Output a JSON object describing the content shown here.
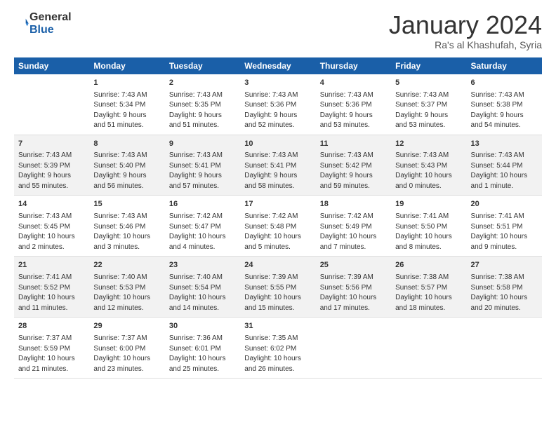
{
  "logo": {
    "line1": "General",
    "line2": "Blue"
  },
  "header": {
    "month": "January 2024",
    "location": "Ra's al Khashufah, Syria"
  },
  "weekdays": [
    "Sunday",
    "Monday",
    "Tuesday",
    "Wednesday",
    "Thursday",
    "Friday",
    "Saturday"
  ],
  "weeks": [
    [
      {
        "day": "",
        "info": ""
      },
      {
        "day": "1",
        "info": "Sunrise: 7:43 AM\nSunset: 5:34 PM\nDaylight: 9 hours\nand 51 minutes."
      },
      {
        "day": "2",
        "info": "Sunrise: 7:43 AM\nSunset: 5:35 PM\nDaylight: 9 hours\nand 51 minutes."
      },
      {
        "day": "3",
        "info": "Sunrise: 7:43 AM\nSunset: 5:36 PM\nDaylight: 9 hours\nand 52 minutes."
      },
      {
        "day": "4",
        "info": "Sunrise: 7:43 AM\nSunset: 5:36 PM\nDaylight: 9 hours\nand 53 minutes."
      },
      {
        "day": "5",
        "info": "Sunrise: 7:43 AM\nSunset: 5:37 PM\nDaylight: 9 hours\nand 53 minutes."
      },
      {
        "day": "6",
        "info": "Sunrise: 7:43 AM\nSunset: 5:38 PM\nDaylight: 9 hours\nand 54 minutes."
      }
    ],
    [
      {
        "day": "7",
        "info": "Sunrise: 7:43 AM\nSunset: 5:39 PM\nDaylight: 9 hours\nand 55 minutes."
      },
      {
        "day": "8",
        "info": "Sunrise: 7:43 AM\nSunset: 5:40 PM\nDaylight: 9 hours\nand 56 minutes."
      },
      {
        "day": "9",
        "info": "Sunrise: 7:43 AM\nSunset: 5:41 PM\nDaylight: 9 hours\nand 57 minutes."
      },
      {
        "day": "10",
        "info": "Sunrise: 7:43 AM\nSunset: 5:41 PM\nDaylight: 9 hours\nand 58 minutes."
      },
      {
        "day": "11",
        "info": "Sunrise: 7:43 AM\nSunset: 5:42 PM\nDaylight: 9 hours\nand 59 minutes."
      },
      {
        "day": "12",
        "info": "Sunrise: 7:43 AM\nSunset: 5:43 PM\nDaylight: 10 hours\nand 0 minutes."
      },
      {
        "day": "13",
        "info": "Sunrise: 7:43 AM\nSunset: 5:44 PM\nDaylight: 10 hours\nand 1 minute."
      }
    ],
    [
      {
        "day": "14",
        "info": "Sunrise: 7:43 AM\nSunset: 5:45 PM\nDaylight: 10 hours\nand 2 minutes."
      },
      {
        "day": "15",
        "info": "Sunrise: 7:43 AM\nSunset: 5:46 PM\nDaylight: 10 hours\nand 3 minutes."
      },
      {
        "day": "16",
        "info": "Sunrise: 7:42 AM\nSunset: 5:47 PM\nDaylight: 10 hours\nand 4 minutes."
      },
      {
        "day": "17",
        "info": "Sunrise: 7:42 AM\nSunset: 5:48 PM\nDaylight: 10 hours\nand 5 minutes."
      },
      {
        "day": "18",
        "info": "Sunrise: 7:42 AM\nSunset: 5:49 PM\nDaylight: 10 hours\nand 7 minutes."
      },
      {
        "day": "19",
        "info": "Sunrise: 7:41 AM\nSunset: 5:50 PM\nDaylight: 10 hours\nand 8 minutes."
      },
      {
        "day": "20",
        "info": "Sunrise: 7:41 AM\nSunset: 5:51 PM\nDaylight: 10 hours\nand 9 minutes."
      }
    ],
    [
      {
        "day": "21",
        "info": "Sunrise: 7:41 AM\nSunset: 5:52 PM\nDaylight: 10 hours\nand 11 minutes."
      },
      {
        "day": "22",
        "info": "Sunrise: 7:40 AM\nSunset: 5:53 PM\nDaylight: 10 hours\nand 12 minutes."
      },
      {
        "day": "23",
        "info": "Sunrise: 7:40 AM\nSunset: 5:54 PM\nDaylight: 10 hours\nand 14 minutes."
      },
      {
        "day": "24",
        "info": "Sunrise: 7:39 AM\nSunset: 5:55 PM\nDaylight: 10 hours\nand 15 minutes."
      },
      {
        "day": "25",
        "info": "Sunrise: 7:39 AM\nSunset: 5:56 PM\nDaylight: 10 hours\nand 17 minutes."
      },
      {
        "day": "26",
        "info": "Sunrise: 7:38 AM\nSunset: 5:57 PM\nDaylight: 10 hours\nand 18 minutes."
      },
      {
        "day": "27",
        "info": "Sunrise: 7:38 AM\nSunset: 5:58 PM\nDaylight: 10 hours\nand 20 minutes."
      }
    ],
    [
      {
        "day": "28",
        "info": "Sunrise: 7:37 AM\nSunset: 5:59 PM\nDaylight: 10 hours\nand 21 minutes."
      },
      {
        "day": "29",
        "info": "Sunrise: 7:37 AM\nSunset: 6:00 PM\nDaylight: 10 hours\nand 23 minutes."
      },
      {
        "day": "30",
        "info": "Sunrise: 7:36 AM\nSunset: 6:01 PM\nDaylight: 10 hours\nand 25 minutes."
      },
      {
        "day": "31",
        "info": "Sunrise: 7:35 AM\nSunset: 6:02 PM\nDaylight: 10 hours\nand 26 minutes."
      },
      {
        "day": "",
        "info": ""
      },
      {
        "day": "",
        "info": ""
      },
      {
        "day": "",
        "info": ""
      }
    ]
  ]
}
